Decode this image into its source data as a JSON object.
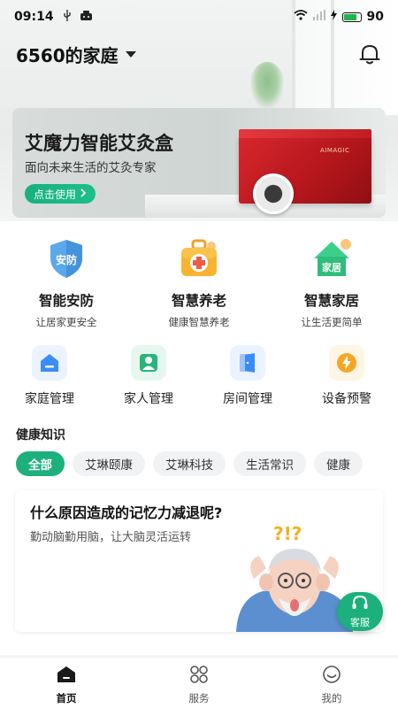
{
  "status_bar": {
    "time": "09:14",
    "battery": "90",
    "icons": [
      "usb-icon",
      "android-icon",
      "wifi-icon",
      "signal-icon",
      "charging-icon",
      "battery-icon"
    ]
  },
  "header": {
    "title": "6560的家庭",
    "icons": [
      "chevron-down-icon",
      "bell-icon"
    ]
  },
  "banner": {
    "title": "艾魔力智能艾灸盒",
    "subtitle": "面向未来生活的艾灸专家",
    "button": "点击使用",
    "product_brand": "AIMAGIC"
  },
  "features": [
    {
      "title": "智能安防",
      "subtitle": "让居家更安全",
      "icon": "shield-icon",
      "icon_text": "安防",
      "color": "#4fa3e6"
    },
    {
      "title": "智慧养老",
      "subtitle": "健康智慧养老",
      "icon": "medical-kit-icon",
      "icon_text": "",
      "color": "#f5a623"
    },
    {
      "title": "智慧家居",
      "subtitle": "让生活更简单",
      "icon": "house-icon",
      "icon_text": "家居",
      "color": "#2ec27e"
    }
  ],
  "services": [
    {
      "label": "家庭管理",
      "icon": "home-manage-icon",
      "color": "#3a8df5",
      "bg": "#eaf3ff"
    },
    {
      "label": "家人管理",
      "icon": "person-icon",
      "color": "#26b57a",
      "bg": "#e6f7ef"
    },
    {
      "label": "房间管理",
      "icon": "door-icon",
      "color": "#3a8df5",
      "bg": "#eaf3ff"
    },
    {
      "label": "设备预警",
      "icon": "alert-bolt-icon",
      "color": "#f5a623",
      "bg": "#fff5e5"
    }
  ],
  "health": {
    "title": "健康知识",
    "chips": [
      "全部",
      "艾琳颐康",
      "艾琳科技",
      "生活常识",
      "健康"
    ],
    "active_chip": 0,
    "article": {
      "title": "什么原因造成的记忆力减退呢?",
      "subtitle": "勤动脑勤用脑，让大脑灵活运转",
      "illustration_text": "?!?"
    },
    "kefu_label": "客服"
  },
  "nav": [
    {
      "label": "首页",
      "icon": "home-icon",
      "active": true
    },
    {
      "label": "服务",
      "icon": "grid-icon",
      "active": false
    },
    {
      "label": "我的",
      "icon": "smile-icon",
      "active": false
    }
  ],
  "colors": {
    "accent": "#1bb07c",
    "banner_red": "#c21d22"
  }
}
